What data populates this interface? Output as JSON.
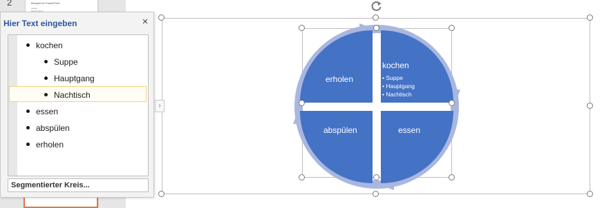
{
  "thumbnail": {
    "slide_number": "2",
    "title_line": "Beispiel für PowerPoint",
    "line_1": "Layout",
    "line_2": "Lorem ipsum"
  },
  "text_pane": {
    "title": "Hier Text eingeben",
    "close_glyph": "×",
    "items": [
      {
        "label": "kochen",
        "level": 1
      },
      {
        "label": "Suppe",
        "level": 2
      },
      {
        "label": "Hauptgang",
        "level": 2
      },
      {
        "label": "Nachtisch",
        "level": 2
      },
      {
        "label": "essen",
        "level": 1
      },
      {
        "label": "abspülen",
        "level": 1
      },
      {
        "label": "erholen",
        "level": 1
      }
    ],
    "footer_link": "Segmentierter Kreis...",
    "toggle_glyph": "›"
  },
  "smartart": {
    "segments": {
      "kochen": "kochen",
      "essen": "essen",
      "abspuelen": "abspülen",
      "erholen": "erholen"
    },
    "kochen_sub": [
      "Suppe",
      "Hauptgang",
      "Nachtisch"
    ],
    "colors": {
      "segment_fill": "#4472c4",
      "arrow_ring": "#a9b7e0",
      "selection_handle": "#777777"
    }
  },
  "icons": {
    "close": "close-icon",
    "rotate": "rotate-icon",
    "expand": "chevron-right-icon"
  }
}
